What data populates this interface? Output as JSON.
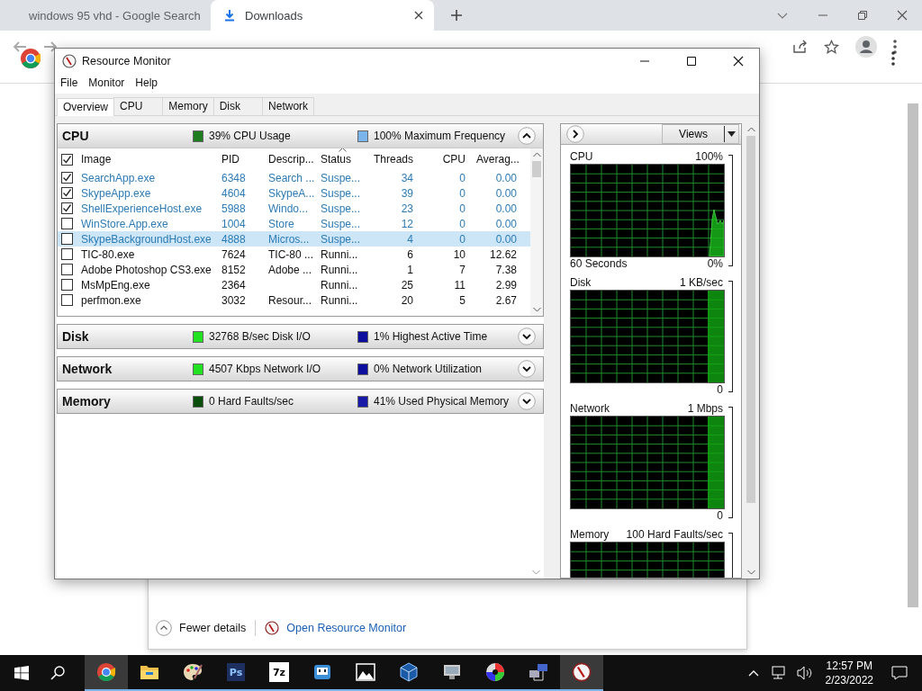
{
  "browser": {
    "tabs": [
      {
        "kind": "search",
        "label": "windows 95 vhd - Google Search",
        "selected": false
      },
      {
        "kind": "download",
        "label": "Downloads",
        "selected": true
      }
    ]
  },
  "resource_monitor": {
    "title": "Resource Monitor",
    "menu": [
      "File",
      "Monitor",
      "Help"
    ],
    "tabs": [
      {
        "label": "Overview",
        "selected": true
      },
      {
        "label": "CPU",
        "selected": false
      },
      {
        "label": "Memory",
        "selected": false
      },
      {
        "label": "Disk",
        "selected": false
      },
      {
        "label": "Network",
        "selected": false
      }
    ],
    "sections": [
      {
        "title": "CPU",
        "expanded": true,
        "metrics": [
          {
            "text": "39% CPU Usage",
            "color": "#1e7d1e"
          },
          {
            "text": "100% Maximum Frequency",
            "color": "#7ab4ea"
          }
        ],
        "table": {
          "all_checked": true,
          "columns": [
            {
              "label": "Image",
              "sorted": false
            },
            {
              "label": "PID",
              "sorted": false
            },
            {
              "label": "Descrip...",
              "sorted": false
            },
            {
              "label": "Status",
              "sorted": true
            },
            {
              "label": "Threads",
              "sorted": false
            },
            {
              "label": "CPU",
              "sorted": false
            },
            {
              "label": "Averag...",
              "sorted": false
            }
          ],
          "rows": [
            {
              "checked": true,
              "suspended": true,
              "selected": false,
              "image": "SearchApp.exe",
              "pid": "6348",
              "description": "Search ...",
              "status": "Suspe...",
              "threads": "34",
              "cpu": "0",
              "average": "0.00"
            },
            {
              "checked": true,
              "suspended": true,
              "selected": false,
              "image": "SkypeApp.exe",
              "pid": "4604",
              "description": "SkypeA...",
              "status": "Suspe...",
              "threads": "39",
              "cpu": "0",
              "average": "0.00"
            },
            {
              "checked": true,
              "suspended": true,
              "selected": false,
              "image": "ShellExperienceHost.exe",
              "pid": "5988",
              "description": "Windo...",
              "status": "Suspe...",
              "threads": "23",
              "cpu": "0",
              "average": "0.00"
            },
            {
              "checked": false,
              "suspended": true,
              "selected": false,
              "image": "WinStore.App.exe",
              "pid": "1004",
              "description": "Store",
              "status": "Suspe...",
              "threads": "12",
              "cpu": "0",
              "average": "0.00"
            },
            {
              "checked": false,
              "suspended": true,
              "selected": true,
              "image": "SkypeBackgroundHost.exe",
              "pid": "4888",
              "description": "Micros...",
              "status": "Suspe...",
              "threads": "4",
              "cpu": "0",
              "average": "0.00"
            },
            {
              "checked": false,
              "suspended": false,
              "selected": false,
              "image": "TIC-80.exe",
              "pid": "7624",
              "description": "TIC-80 ...",
              "status": "Runni...",
              "threads": "6",
              "cpu": "10",
              "average": "12.62"
            },
            {
              "checked": false,
              "suspended": false,
              "selected": false,
              "image": "Adobe Photoshop CS3.exe",
              "pid": "8152",
              "description": "Adobe ...",
              "status": "Runni...",
              "threads": "1",
              "cpu": "7",
              "average": "7.38"
            },
            {
              "checked": false,
              "suspended": false,
              "selected": false,
              "image": "MsMpEng.exe",
              "pid": "2364",
              "status": "Runni...",
              "threads": "25",
              "cpu": "11",
              "average": "2.99"
            },
            {
              "checked": false,
              "suspended": false,
              "selected": false,
              "image": "perfmon.exe",
              "pid": "3032",
              "description": "Resour...",
              "status": "Runni...",
              "threads": "20",
              "cpu": "5",
              "average": "2.67"
            }
          ]
        }
      },
      {
        "title": "Disk",
        "expanded": false,
        "metrics": [
          {
            "text": "32768 B/sec Disk I/O",
            "color": "#22e022"
          },
          {
            "text": "1% Highest Active Time",
            "color": "#0d0d9e"
          }
        ]
      },
      {
        "title": "Network",
        "expanded": false,
        "metrics": [
          {
            "text": "4507 Kbps Network I/O",
            "color": "#22e022"
          },
          {
            "text": "0% Network Utilization",
            "color": "#0d0d9e"
          }
        ]
      },
      {
        "title": "Memory",
        "expanded": false,
        "metrics": [
          {
            "text": "0 Hard Faults/sec",
            "color": "#0b4d0b"
          },
          {
            "text": "41% Used Physical Memory",
            "color": "#1a1aa8"
          }
        ]
      }
    ],
    "graph_panel": {
      "views_button": "Views",
      "graphs": [
        {
          "kind": "spike",
          "title": "CPU",
          "max": "100%",
          "footer": "60 Seconds",
          "min": "0%"
        },
        {
          "kind": "band",
          "title": "Disk",
          "max": "1 KB/sec",
          "min": "0"
        },
        {
          "kind": "band",
          "title": "Network",
          "max": "1 Mbps",
          "min": "0"
        },
        {
          "kind": "empty",
          "title": "Memory",
          "max": "100 Hard Faults/sec"
        }
      ]
    }
  },
  "task_manager": {
    "fewer_details": "Fewer details",
    "link": "Open Resource Monitor"
  },
  "taskbar": {
    "apps": [
      {
        "kind": "chrome",
        "active": true
      },
      {
        "kind": "folder",
        "active": false
      },
      {
        "kind": "palette",
        "active": false
      },
      {
        "kind": "ps",
        "label": "Ps",
        "active": false
      },
      {
        "kind": "archive",
        "label": "7z",
        "active": false
      },
      {
        "kind": "robot",
        "active": false
      },
      {
        "kind": "photos",
        "active": false
      },
      {
        "kind": "cube",
        "active": false
      },
      {
        "kind": "monitor",
        "active": false
      },
      {
        "kind": "disc",
        "active": false
      },
      {
        "kind": "network",
        "active": false
      },
      {
        "kind": "gauge",
        "active": true
      }
    ],
    "time": "12:57 PM",
    "date": "2/23/2022"
  }
}
